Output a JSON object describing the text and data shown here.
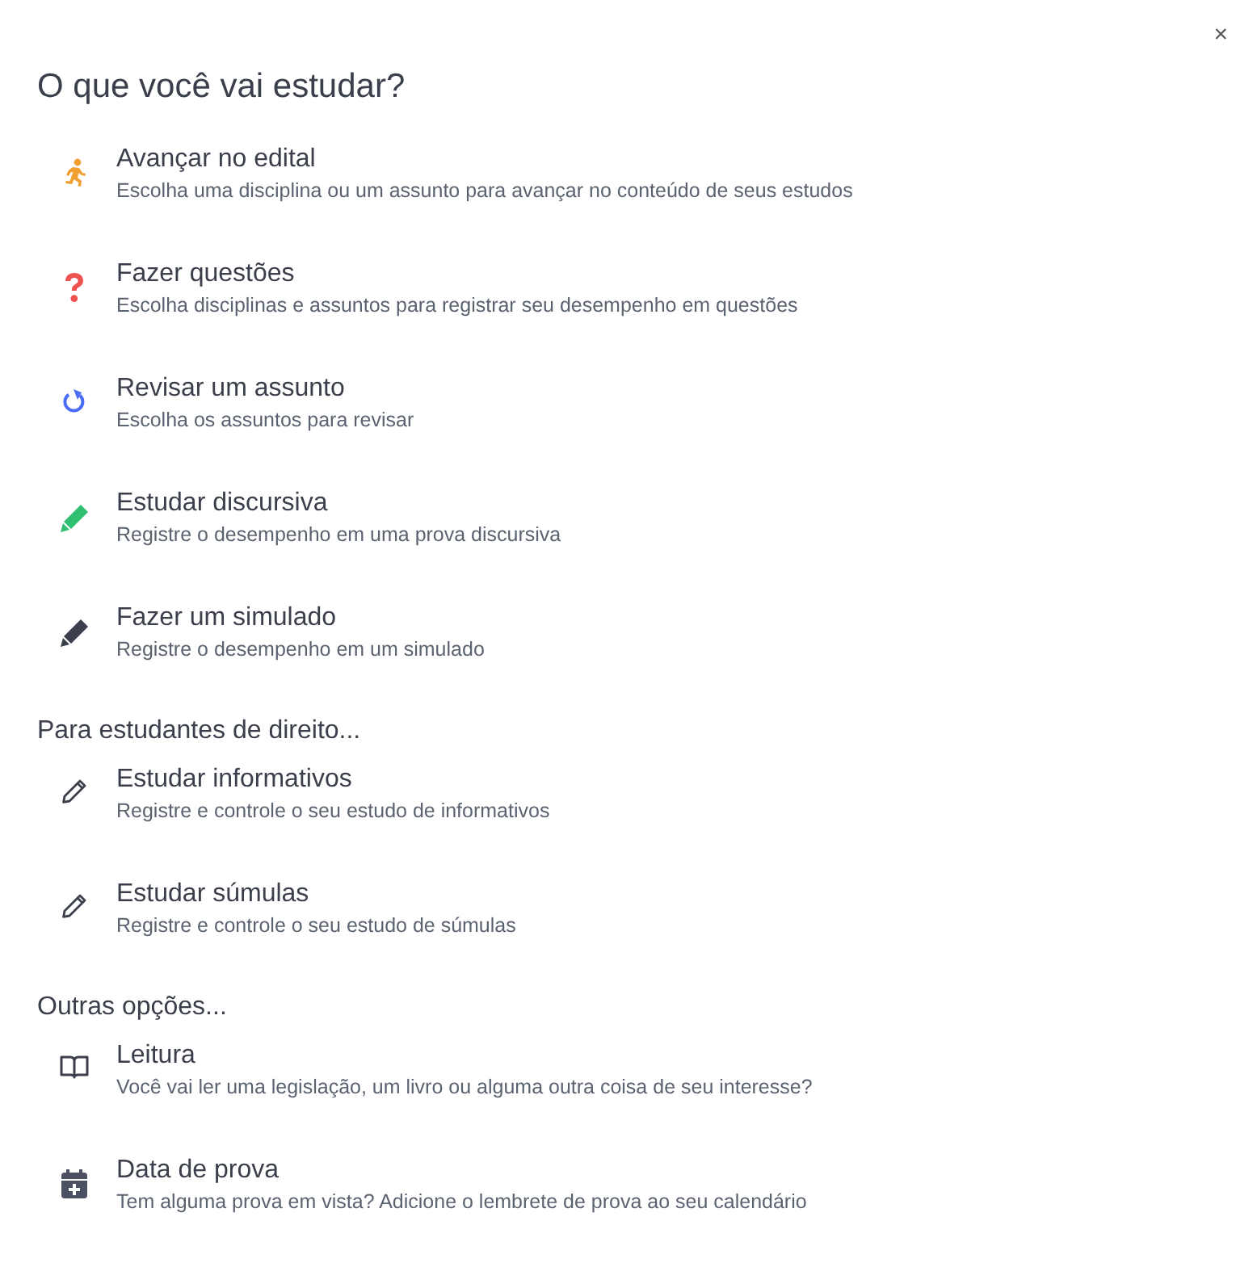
{
  "close": "×",
  "title": "O que você vai estudar?",
  "sections": [
    {
      "items": [
        {
          "kind": "run",
          "title": "Avançar no edital",
          "description": "Escolha uma disciplina ou um assunto para avançar no conteúdo de seus estudos"
        },
        {
          "kind": "question",
          "title": "Fazer questões",
          "description": "Escolha disciplinas e assuntos para registrar seu desempenho em questões"
        },
        {
          "kind": "review",
          "title": "Revisar um assunto",
          "description": "Escolha os assuntos para revisar"
        },
        {
          "kind": "essay",
          "title": "Estudar discursiva",
          "description": "Registre o desempenho em uma prova discursiva"
        },
        {
          "kind": "mock",
          "title": "Fazer um simulado",
          "description": "Registre o desempenho em um simulado"
        }
      ]
    },
    {
      "heading": "Para estudantes de direito...",
      "items": [
        {
          "kind": "law",
          "title": "Estudar informativos",
          "description": "Registre e controle o seu estudo de informativos"
        },
        {
          "kind": "law",
          "title": "Estudar súmulas",
          "description": "Registre e controle o seu estudo de súmulas"
        }
      ]
    },
    {
      "heading": "Outras opções...",
      "items": [
        {
          "kind": "reading",
          "title": "Leitura",
          "description": "Você vai ler uma legislação, um livro ou alguma outra coisa de seu interesse?"
        },
        {
          "kind": "exam",
          "title": "Data de prova",
          "description": "Tem alguma prova em vista? Adicione o lembrete de prova ao seu calendário"
        }
      ]
    }
  ]
}
